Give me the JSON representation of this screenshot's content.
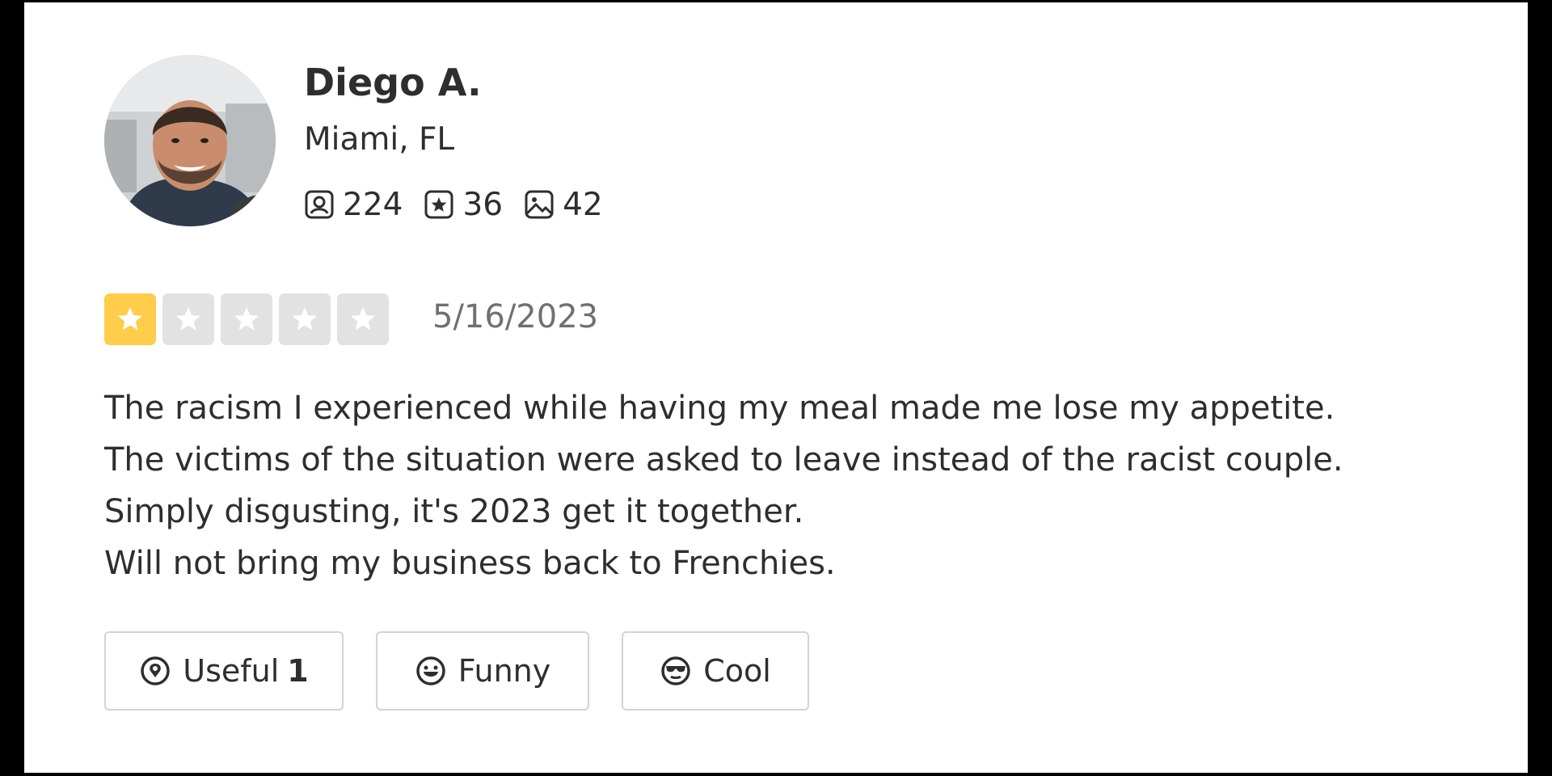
{
  "user": {
    "name": "Diego A.",
    "location": "Miami, FL",
    "stats": {
      "friends": "224",
      "reviews": "36",
      "photos": "42"
    }
  },
  "review": {
    "rating": 1,
    "max_rating": 5,
    "date": "5/16/2023",
    "lines": [
      "The racism I experienced while having my meal made me lose my appetite.",
      "The victims of the situation were asked to leave instead of the racist couple.",
      "Simply disgusting, it's 2023 get it together.",
      "Will not bring my business back to Frenchies."
    ]
  },
  "reactions": {
    "useful": {
      "label": "Useful",
      "count": "1"
    },
    "funny": {
      "label": "Funny"
    },
    "cool": {
      "label": "Cool"
    }
  },
  "colors": {
    "star_filled": "#ffcc4b",
    "star_empty": "#e2e2e2",
    "text": "#2d2e2f",
    "muted": "#6e7072"
  },
  "icons": [
    "friends-icon",
    "reviews-icon",
    "photos-icon",
    "star-icon",
    "useful-icon",
    "funny-icon",
    "cool-icon"
  ]
}
